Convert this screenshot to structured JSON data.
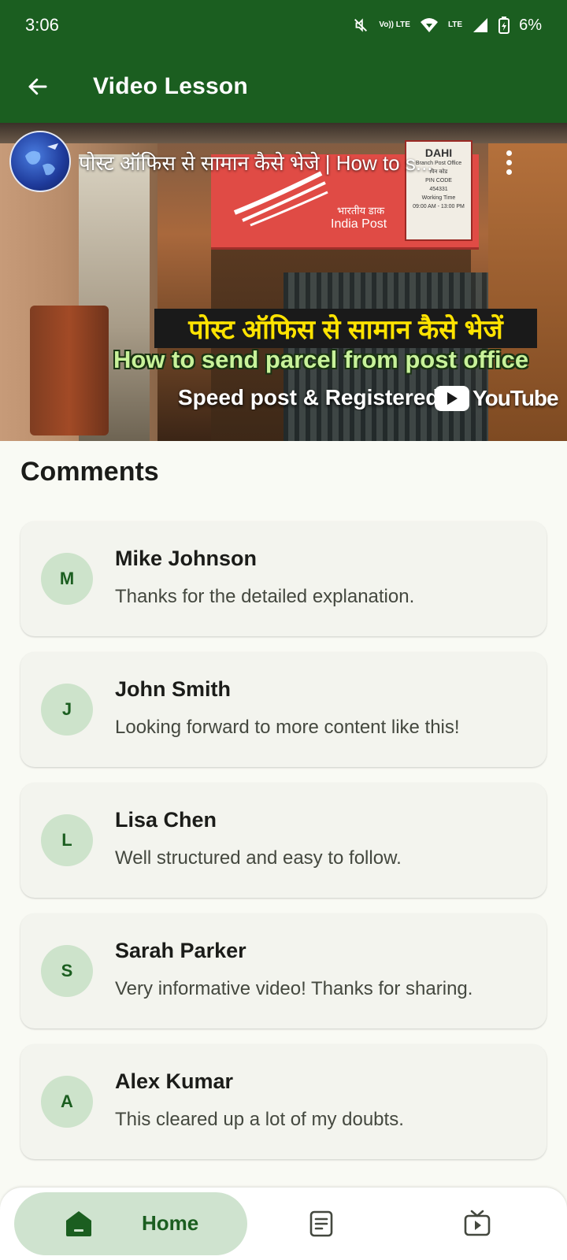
{
  "status_bar": {
    "time": "3:06",
    "volte_label": "Vo)) LTE",
    "lte_label": "LTE",
    "battery": "6%",
    "icons": [
      "mute-icon",
      "volte-icon",
      "wifi-icon",
      "signal-icon",
      "battery-icon"
    ]
  },
  "app_bar": {
    "title": "Video Lesson",
    "back_icon": "arrow-left-icon"
  },
  "video": {
    "title": "पोस्ट ऑफिस से सामान कैसे भेजे | How to s...",
    "overlay_hindi": "पोस्ट ऑफिस से सामान कैसे भेजें",
    "overlay_english": "How to send parcel from post office",
    "overlay_sub": "Speed post & Registered post",
    "youtube_label": "YouTube",
    "sign": {
      "hindi": "भारतीय डाक",
      "english": "India Post",
      "board_title": "DAHI",
      "board_line1": "Branch Post Office",
      "board_line2": "पिन कोड",
      "board_line3": "PIN CODE",
      "board_line4": "454331",
      "board_line5": "Working Time",
      "board_line6": "09:00 AM - 13:00 PM"
    }
  },
  "comments": {
    "heading": "Comments",
    "items": [
      {
        "initial": "M",
        "name": "Mike Johnson",
        "text": "Thanks for the detailed explanation."
      },
      {
        "initial": "J",
        "name": "John Smith",
        "text": "Looking forward to more content like this!"
      },
      {
        "initial": "L",
        "name": "Lisa Chen",
        "text": "Well structured and easy to follow."
      },
      {
        "initial": "S",
        "name": "Sarah Parker",
        "text": "Very informative video! Thanks for sharing."
      },
      {
        "initial": "A",
        "name": "Alex Kumar",
        "text": "This cleared up a lot of my doubts."
      }
    ]
  },
  "bottom_nav": {
    "home_label": "Home",
    "items": [
      "home-icon",
      "notes-icon",
      "video-icon"
    ]
  },
  "colors": {
    "primary": "#1b5e20",
    "background": "#f9faf4",
    "card": "#f3f4ee",
    "avatar_bg": "#cde3cb",
    "nav_active": "#cfe3cf"
  }
}
